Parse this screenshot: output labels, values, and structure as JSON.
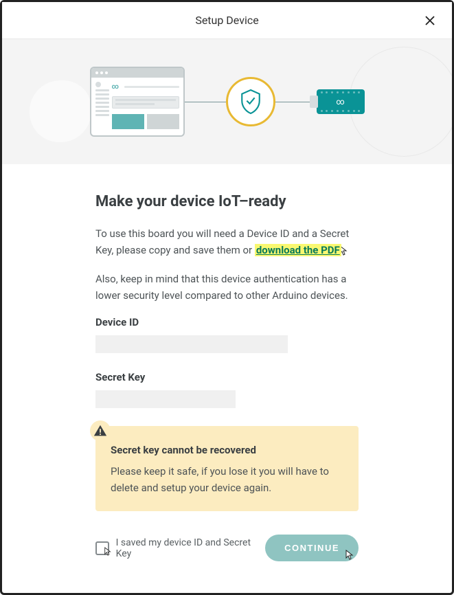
{
  "header": {
    "title": "Setup Device"
  },
  "main": {
    "heading": "Make your device IoT–ready",
    "paragraph1_prefix": "To use this board you will need a Device ID and a Secret Key, please copy and save them or ",
    "pdf_link_text": "download the PDF",
    "paragraph2": "Also, keep in mind that this device authentication has a lower security level compared to other Arduino devices.",
    "device_id_label": "Device ID",
    "device_id_value": "",
    "secret_key_label": "Secret Key",
    "secret_key_value": ""
  },
  "warning": {
    "title": "Secret key cannot be recovered",
    "text": "Please keep it safe, if you lose it you will have to delete and setup your device again."
  },
  "footer": {
    "checkbox_label": "I saved my device ID and Secret Key",
    "continue_label": "CONTINUE"
  }
}
